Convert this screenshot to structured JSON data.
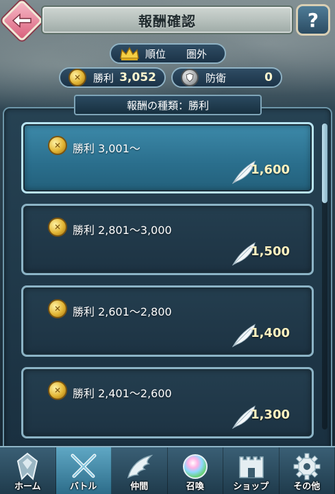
{
  "header": {
    "title": "報酬確認"
  },
  "help": {
    "label": "?"
  },
  "rank": {
    "label": "順位",
    "value": "圏外"
  },
  "wins": {
    "label": "勝利",
    "value": "3,052"
  },
  "defense": {
    "label": "防衛",
    "value": "0"
  },
  "reward_type": {
    "text": "報酬の種類：勝利"
  },
  "rewards": [
    {
      "label": "勝利",
      "range": "3,001～",
      "amount": "1,600",
      "selected": true
    },
    {
      "label": "勝利",
      "range": "2,801～3,000",
      "amount": "1,500",
      "selected": false
    },
    {
      "label": "勝利",
      "range": "2,601～2,800",
      "amount": "1,400",
      "selected": false
    },
    {
      "label": "勝利",
      "range": "2,401～2,600",
      "amount": "1,300",
      "selected": false
    }
  ],
  "nav": [
    {
      "label": "ホーム",
      "icon": "home-crest-icon"
    },
    {
      "label": "バトル",
      "icon": "crossed-swords-icon"
    },
    {
      "label": "仲間",
      "icon": "wing-icon"
    },
    {
      "label": "召喚",
      "icon": "orb-icon"
    },
    {
      "label": "ショップ",
      "icon": "castle-icon"
    },
    {
      "label": "その他",
      "icon": "gear-icon"
    }
  ],
  "colors": {
    "accent": "#8cb4c6",
    "selected_card": "#3d8aaa",
    "amount": "#fff3c0",
    "back_button": "#d9607c"
  }
}
